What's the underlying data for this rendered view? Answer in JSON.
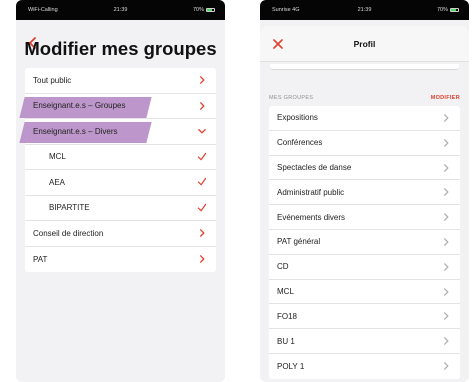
{
  "colors": {
    "accent_red": "#e0412f",
    "highlight_purple": "#b78ec7",
    "chevron_gray": "#b0b0b5"
  },
  "left": {
    "status": {
      "carrier": "WiFi-Calling",
      "time": "21:39",
      "battery": "70%"
    },
    "back_icon": "chevron-left-icon",
    "title": "Modifier mes groupes",
    "rows": [
      {
        "label": "Tout public",
        "icon": "chevron-right-icon"
      },
      {
        "label": "Enseignant.e.s – Groupes",
        "icon": "chevron-right-icon",
        "highlighted": true
      },
      {
        "label": "Enseignant.e.s – Divers",
        "icon": "chevron-down-icon",
        "highlighted": true
      },
      {
        "label": "MCL",
        "icon": "checkmark-icon",
        "indent": true
      },
      {
        "label": "AEA",
        "icon": "checkmark-icon",
        "indent": true
      },
      {
        "label": "BIPARTITE",
        "icon": "checkmark-icon",
        "indent": true
      },
      {
        "label": "Conseil de direction",
        "icon": "chevron-right-icon"
      },
      {
        "label": "PAT",
        "icon": "chevron-right-icon"
      }
    ]
  },
  "right": {
    "status": {
      "carrier": "Sunrise 4G",
      "time": "21:39",
      "battery": "70%"
    },
    "close_icon": "close-icon",
    "title": "Profil",
    "section_title": "MES GROUPES",
    "section_action": "MODIFIER",
    "rows": [
      {
        "label": "Expositions"
      },
      {
        "label": "Conférences"
      },
      {
        "label": "Spectacles de danse"
      },
      {
        "label": "Administratif public"
      },
      {
        "label": "Evénements divers"
      },
      {
        "label": "PAT général"
      },
      {
        "label": "CD"
      },
      {
        "label": "MCL"
      },
      {
        "label": "FO18"
      },
      {
        "label": "BU 1"
      },
      {
        "label": "POLY 1"
      }
    ]
  }
}
